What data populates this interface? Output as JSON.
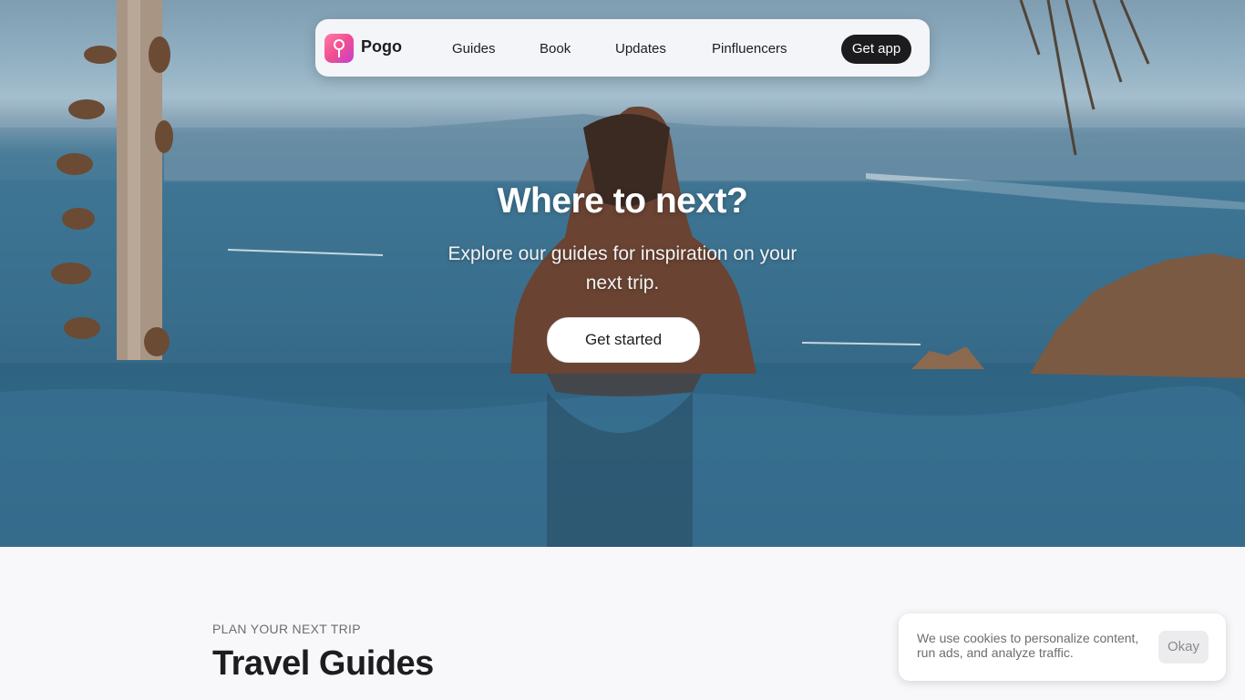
{
  "nav": {
    "brand": "Pogo",
    "links": [
      "Guides",
      "Book",
      "Updates",
      "Pinfluencers"
    ],
    "cta": "Get app"
  },
  "hero": {
    "title": "Where to next?",
    "subtitle": "Explore our guides for inspiration on your next trip.",
    "cta": "Get started"
  },
  "section": {
    "eyebrow": "PLAN YOUR NEXT TRIP",
    "title": "Travel Guides"
  },
  "cookie": {
    "text": "We use cookies to personalize content, run ads, and analyze traffic.",
    "button": "Okay"
  },
  "colors": {
    "brand_gradient_start": "#ff7aa8",
    "brand_gradient_end": "#c43fd6",
    "dark_button": "#1c1c1e"
  }
}
